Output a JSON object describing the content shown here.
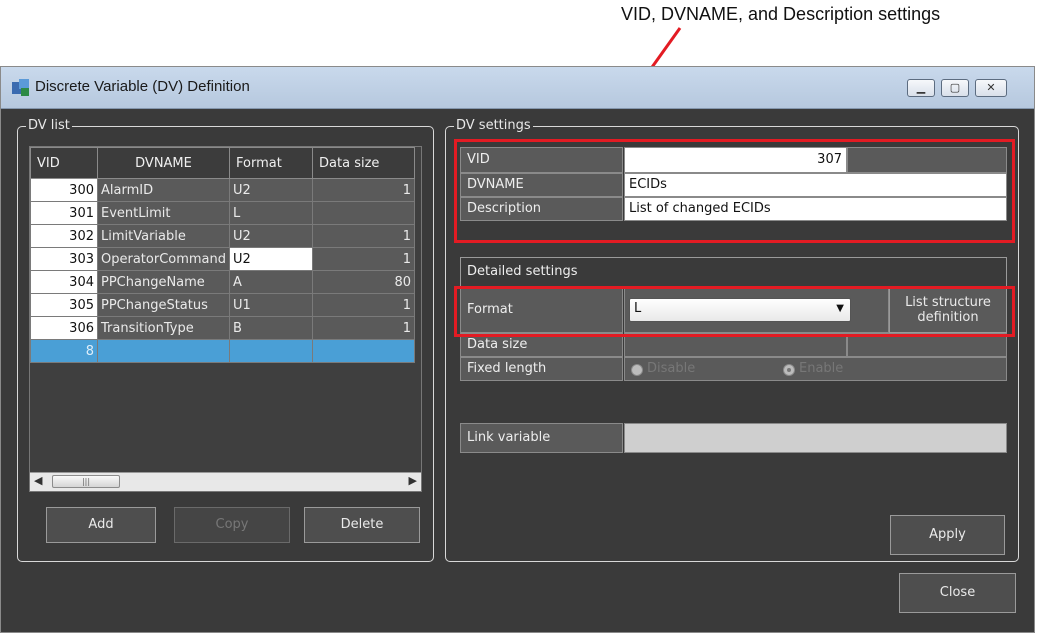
{
  "callouts": {
    "top": "VID, DVNAME, and Description settings"
  },
  "window": {
    "title": "Discrete Variable (DV) Definition",
    "caption_buttons": [
      "minimize",
      "restore",
      "close"
    ]
  },
  "dv_list": {
    "legend": "DV list",
    "columns": [
      "VID",
      "DVNAME",
      "Format",
      "Data size"
    ],
    "rows": [
      {
        "vid": "300",
        "name": "AlarmID",
        "format": "U2",
        "size": "1"
      },
      {
        "vid": "301",
        "name": "EventLimit",
        "format": "L",
        "size": ""
      },
      {
        "vid": "302",
        "name": "LimitVariable",
        "format": "U2",
        "size": "1"
      },
      {
        "vid": "303",
        "name": "OperatorCommand",
        "format": "U2",
        "size": "1"
      },
      {
        "vid": "304",
        "name": "PPChangeName",
        "format": "A",
        "size": "80"
      },
      {
        "vid": "305",
        "name": "PPChangeStatus",
        "format": "U1",
        "size": "1"
      },
      {
        "vid": "306",
        "name": "TransitionType",
        "format": "B",
        "size": "1"
      },
      {
        "vid": "8",
        "name": "",
        "format": "",
        "size": ""
      }
    ],
    "buttons": {
      "add": "Add",
      "copy": "Copy",
      "delete": "Delete"
    }
  },
  "dv_settings": {
    "legend": "DV settings",
    "vid_label": "VID",
    "vid_value": "307",
    "dvname_label": "DVNAME",
    "dvname_value": "ECIDs",
    "description_label": "Description",
    "description_value": "List of changed ECIDs",
    "detailed_header": "Detailed settings",
    "format_label": "Format",
    "format_value": "L",
    "list_structure_button": "List structure definition",
    "data_size_label": "Data size",
    "fixed_length_label": "Fixed length",
    "radio_disable": "Disable",
    "radio_enable": "Enable",
    "link_variable_label": "Link variable",
    "apply_button": "Apply"
  },
  "close_button": "Close",
  "colors": {
    "callout_red": "#e31b23",
    "selection_blue": "#4a9fd6"
  }
}
